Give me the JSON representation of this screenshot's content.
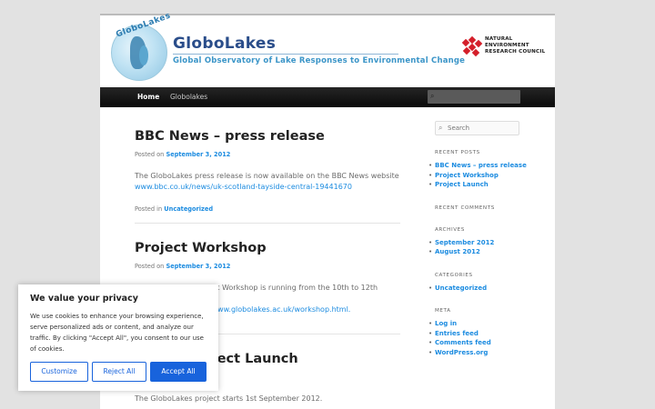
{
  "header": {
    "logo_text": "GloboLakes",
    "site_title": "GloboLakes",
    "site_description": "Global Observatory of Lake Responses to Environmental Change",
    "partner_logo": [
      "NATURAL",
      "ENVIRONMENT",
      "RESEARCH COUNCIL"
    ]
  },
  "nav": {
    "items": [
      "Home",
      "Globolakes"
    ],
    "search_icon": "search-icon"
  },
  "posts": [
    {
      "title": "BBC News – press release",
      "posted_on": "Posted on",
      "date": "September 3, 2012",
      "body": "The GloboLakes press release is now available on the BBC News website",
      "link": "www.bbc.co.uk/news/uk-scotland-tayside-central-19441670",
      "posted_in": "Posted in",
      "category": "Uncategorized"
    },
    {
      "title": "Project Workshop",
      "posted_on": "Posted on",
      "date": "September 3, 2012",
      "body_line1": "The GloboLakes Project Workshop is running from the 10th to 12th December",
      "body_line2_link": "http://www.globolakes.ac.uk/workshop.html."
    },
    {
      "title": "Project Launch",
      "body": "The GloboLakes project starts 1st September 2012."
    }
  ],
  "sidebar": {
    "search_placeholder": "Search",
    "recent_posts_title": "RECENT POSTS",
    "recent_posts": [
      "BBC News – press release",
      "Project Workshop",
      "Project Launch"
    ],
    "recent_comments_title": "RECENT COMMENTS",
    "archives_title": "ARCHIVES",
    "archives": [
      "September 2012",
      "August 2012"
    ],
    "categories_title": "CATEGORIES",
    "categories": [
      "Uncategorized"
    ],
    "meta_title": "META",
    "meta": [
      "Log in",
      "Entries feed",
      "Comments feed",
      "WordPress.org"
    ]
  },
  "cookie": {
    "title": "We value your privacy",
    "text": "We use cookies to enhance your browsing experience, serve personalized ads or content, and analyze our traffic. By clicking \"Accept All\", you consent to our use of cookies.",
    "customize": "Customize",
    "reject": "Reject All",
    "accept": "Accept All"
  }
}
